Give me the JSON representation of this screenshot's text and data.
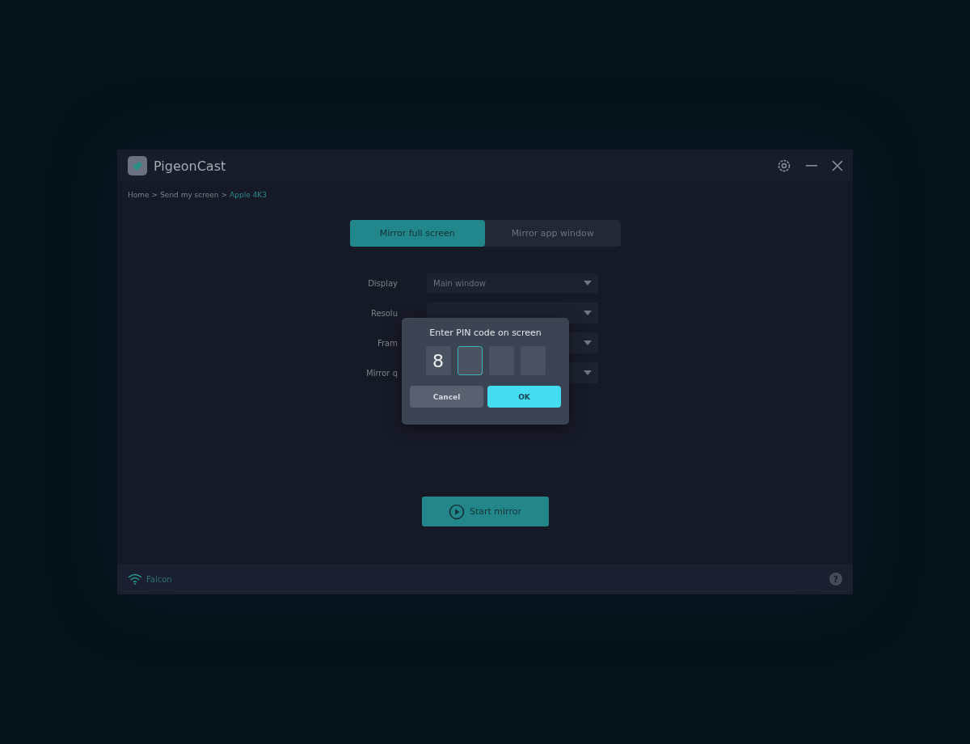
{
  "window": {
    "title": "PigeonCast"
  },
  "breadcrumb": [
    {
      "label": "Home",
      "current": false
    },
    {
      "label": "Send my screen",
      "current": false
    },
    {
      "label": "Apple 4K3",
      "current": true
    }
  ],
  "breadcrumb_separator": ">",
  "tabs": [
    {
      "label": "Mirror full screen",
      "selected": true
    },
    {
      "label": "Mirror app window",
      "selected": false
    }
  ],
  "settings": [
    {
      "label": "Display",
      "value": "Main window"
    },
    {
      "label": "Resolu"
    },
    {
      "label": "Fram"
    },
    {
      "label": "Mirror q"
    }
  ],
  "start_button": {
    "label": "Start mirror"
  },
  "status_bar": {
    "network": "Falcon",
    "help": "?"
  },
  "pin_dialog": {
    "title": "Enter PIN code on screen",
    "digits": [
      {
        "value": "8",
        "focused": false
      },
      {
        "focused": true
      },
      {
        "focused": false
      },
      {
        "focused": false
      }
    ],
    "buttons": [
      {
        "label": "Cancel",
        "kind": "secondary"
      },
      {
        "label": "OK",
        "kind": "primary"
      }
    ]
  }
}
